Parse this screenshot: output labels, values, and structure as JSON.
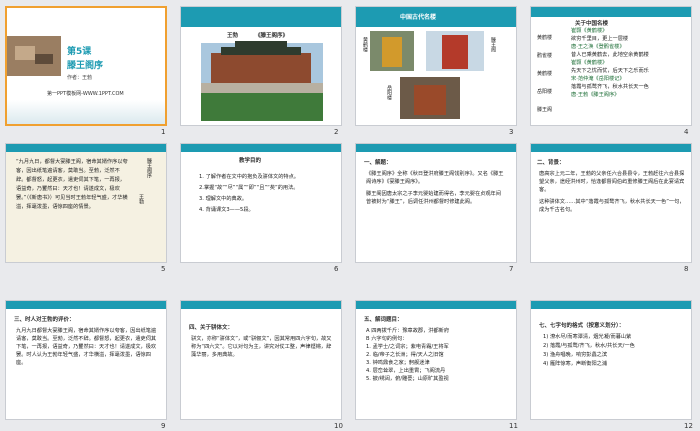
{
  "slides": [
    {
      "num": "1",
      "title": "第5课",
      "subtitle": "滕王阁序",
      "author": "作者：王勃",
      "footer": "第一PPT模板网-WWW.1PPT.COM"
    },
    {
      "num": "2",
      "author": "王勃",
      "title": "《滕王阁序》"
    },
    {
      "num": "3",
      "heading": "中国古代名楼",
      "label1": "黄鹤楼",
      "label2": "滕王阁",
      "label3": "岳阳楼"
    },
    {
      "num": "4",
      "heading": "关于中国名楼",
      "lines": [
        "崔颢《黄鹤楼》",
        "欲穷千里目，更上一层楼",
        "唐·王之涣《登鹳雀楼》",
        "昔人已乘黄鹤去，此地空余黄鹤楼",
        "崔颢《黄鹤楼》",
        "先天下之忧而忧，后天下之乐而乐",
        "宋·范仲淹《岳阳楼记》",
        "落霞与孤鹜齐飞，秋水共长天一色",
        "唐·王勃《滕王阁序》"
      ],
      "side": [
        "黄鹤楼",
        "鹳雀楼",
        "黄鹤楼",
        "岳阳楼",
        "滕王阁"
      ]
    },
    {
      "num": "5",
      "text": "“九月九日，都督大宴滕王阁，宿命其婿作序以夸客，因出纸笔遍请客，莫敢当。至勃，泛然不辞。都督怒，起更衣，遣吏伺其下笔，一再报，语益奇，乃矍然曰：天才也！请遂成文，极欢罢。”（《新唐书》）可见当时王勃年轻气盛，才华横溢，挥毫泼墨，语惊四座的情景。",
      "vert1": "滕王阁序",
      "vert2": "王勃"
    },
    {
      "num": "6",
      "heading": "教学目的",
      "items": [
        "1. 了解作者在文中的抱负及骈体文的特点。",
        "2.掌握“故”“尽”“属”“即”“且”“矣”的用法。",
        "3. 理解文中的典故。",
        "4. 背诵课文3——5段。"
      ]
    },
    {
      "num": "7",
      "heading": "一、解题：",
      "p1": "《滕王阁序》全称《秋日登洪府滕王阁饯别序》。又名《滕王阁诗序》《宴滕王阁序》。",
      "p2": "滕王阁因唐太宗之子李元婴始建而得名，李元婴在贞观年间曾被封为“滕王”，后调任洪州都督时修建此阁。"
    },
    {
      "num": "8",
      "heading": "二、背景：",
      "p1": "唐高宗上元二年，王勃的父亲任六合县县令，王勃赶往六合县探望父亲，途经洪州时，恰逢都督阎伯屿重修滕王阁后在此宴请宾客。",
      "p2": "这种骈体文……其中“落霞与孤鹜齐飞，秋水共长天一色”一句，成为千古名句。"
    },
    {
      "num": "9",
      "heading": "三、时人对王勃的评价：",
      "text": "九月九日都督大宴滕王阁，宿命其婿作序以夸客，因出纸笔遍请客，莫敢当。至勃，泛然不辞。都督怒，起更衣，遣吏伺其下笔，一再报，语益奇，乃矍然曰：天才也！请遂成文，极欢罢。时人认为王勃年轻气盛，才华横溢，挥毫泼墨，语惊四座。"
    },
    {
      "num": "10",
      "heading": "四、关于骈体文：",
      "text": "骈文，亦称“骈体文”，或“骈俪文”，因其常用四六字句，故又称为“四六文”。它以对句为主，讲究对仗工整，声律铿锵，辞藻华丽，多用典故。"
    },
    {
      "num": "11",
      "heading": "五、解词题目：",
      "items": [
        "A 四两拨千斤：豫章故郡，洪都新府",
        "B 六字句的例句：",
        "1. 孟学士/之词宗；紫电青霜/王将军",
        "2. 临/帝子之长洲；得/天人之旧馆",
        "3. 钟鸣鼎食之家；舸舰迷津",
        "4. 层峦耸翠，上出重霄；飞阁流丹",
        "5. 披/绣闼，俯/雕甍；山原旷其盈视"
      ]
    },
    {
      "num": "12",
      "heading": "七、七字句的格式（按意义划分）：",
      "items": [
        "1) 潦水尽/而寒潭清，烟光凝/而暮山紫",
        "2) 落霞/与孤鹜/齐飞，秋水/共长天/一色",
        "3) 渔舟唱晚，响穷彭蠡之滨",
        "4) 雁阵惊寒，声断衡阳之浦"
      ]
    }
  ]
}
